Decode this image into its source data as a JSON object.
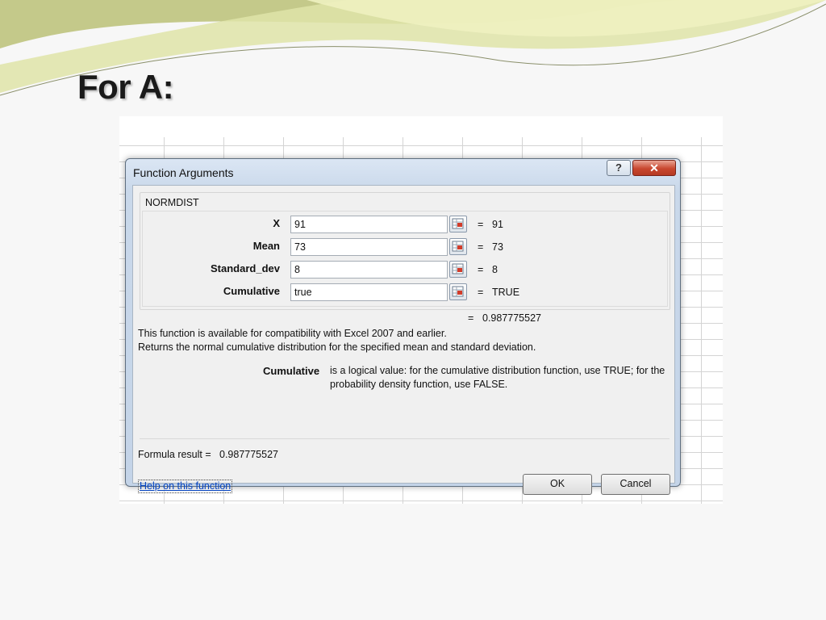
{
  "slide": {
    "title": "For A:"
  },
  "dialog": {
    "title": "Function Arguments",
    "help_button": "?",
    "close_button": "✕",
    "function_name": "NORMDIST",
    "arguments": [
      {
        "label": "X",
        "value": "91",
        "evaluated": "91"
      },
      {
        "label": "Mean",
        "value": "73",
        "evaluated": "73"
      },
      {
        "label": "Standard_dev",
        "value": "8",
        "evaluated": "8"
      },
      {
        "label": "Cumulative",
        "value": "true",
        "evaluated": "TRUE"
      }
    ],
    "equals_sign": "=",
    "result_value": "0.987775527",
    "description_line1": "This function is available for compatibility with Excel 2007 and earlier.",
    "description_line2": "Returns the normal cumulative distribution for the specified mean and standard deviation.",
    "arg_help_name": "Cumulative",
    "arg_help_line1": "is a logical value: for the cumulative distribution function, use TRUE; for the",
    "arg_help_line2": "probability density function, use FALSE.",
    "formula_result_label": "Formula result =",
    "formula_result_value": "0.987775527",
    "help_link": "Help on this function",
    "ok_label": "OK",
    "cancel_label": "Cancel"
  },
  "colors": {
    "accent_swoosh": "#d7df8f",
    "accent_swoosh_dark": "#b9c16c",
    "dialog_frame": "#c9d8ea",
    "close_button": "#c8472f",
    "link": "#0645c2"
  }
}
